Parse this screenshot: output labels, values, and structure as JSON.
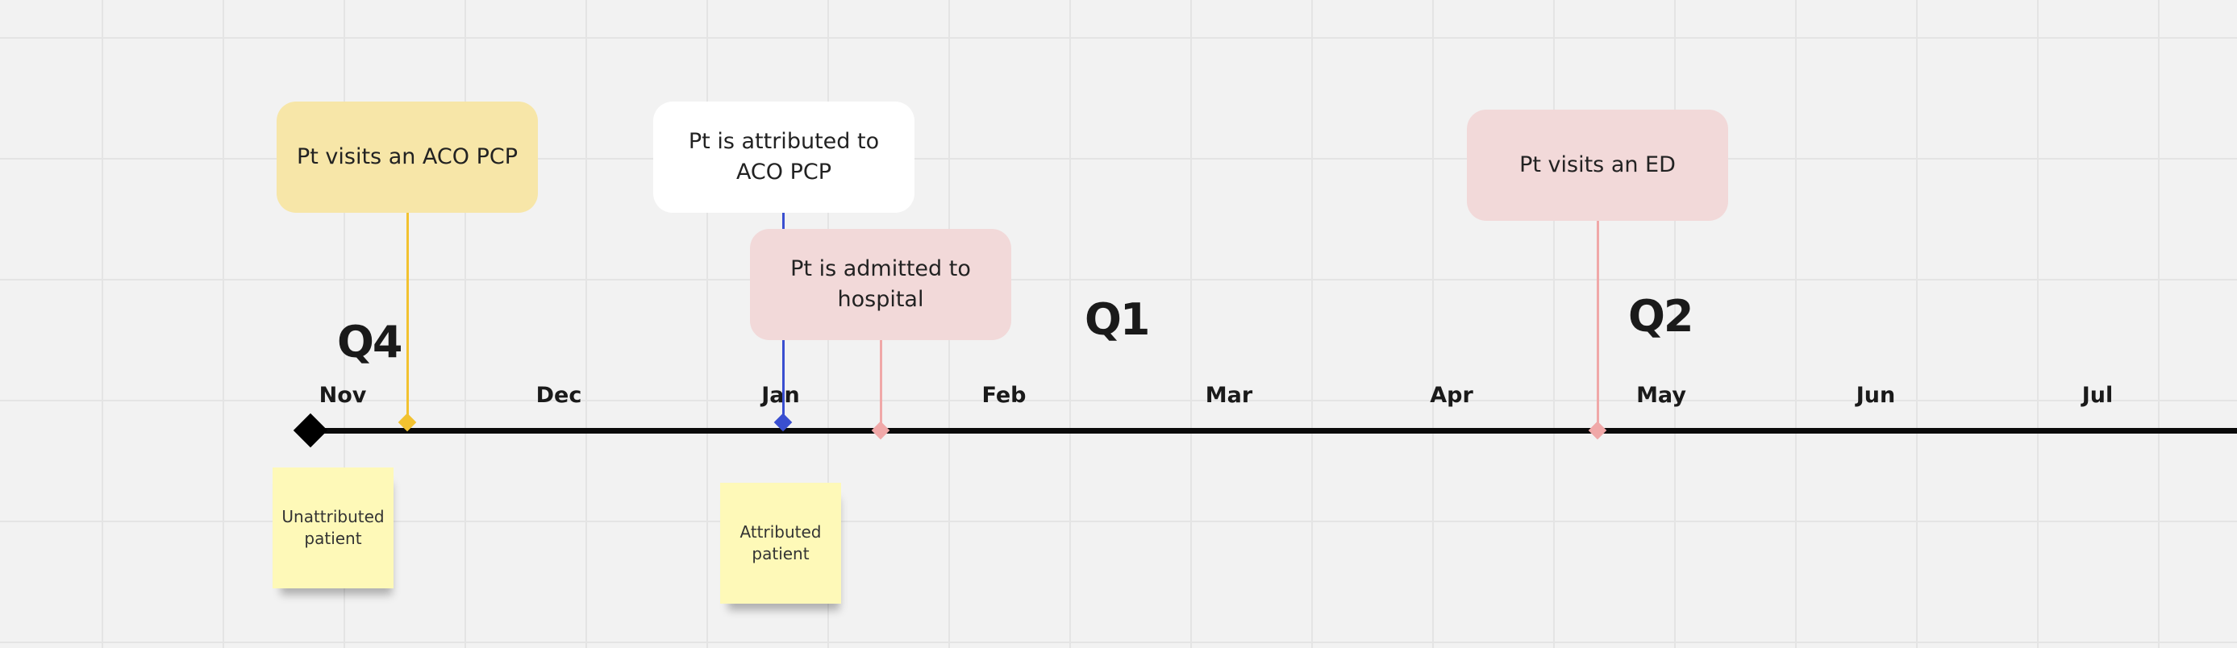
{
  "quarters": {
    "q4": "Q4",
    "q1": "Q1",
    "q2": "Q2"
  },
  "months": [
    "Nov",
    "Dec",
    "Jan",
    "Feb",
    "Mar",
    "Apr",
    "May",
    "Jun",
    "Jul"
  ],
  "events": {
    "aco_pcp_visit": {
      "label": "Pt visits an ACO PCP",
      "color": "#f7e6a8",
      "line_color": "#f2c230"
    },
    "attributed": {
      "label": "Pt is attributed to ACO PCP",
      "color": "#ffffff",
      "line_color": "#3a4fd0"
    },
    "admitted": {
      "label": "Pt is admitted to hospital",
      "color": "#f2d9d9",
      "line_color": "#f0a8a8"
    },
    "ed_visit": {
      "label": "Pt visits an ED",
      "color": "#f2d9d9",
      "line_color": "#f0a8a8"
    }
  },
  "stickies": {
    "unattributed": "Unattributed patient",
    "attributed": "Attributed patient"
  },
  "colors": {
    "timeline": "#0a0a0a",
    "sticky": "#fef9b8",
    "background": "#f2f2f2"
  }
}
